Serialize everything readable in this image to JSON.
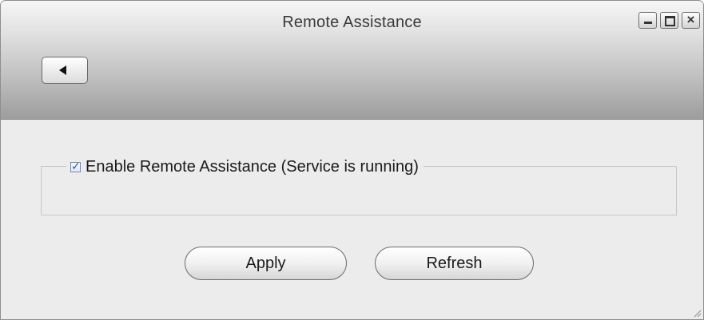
{
  "window": {
    "title": "Remote Assistance",
    "controls": {
      "minimize_icon": "minimize-icon",
      "maximize_icon": "maximize-icon",
      "close_icon": "close-icon",
      "close_glyph": "×"
    },
    "back_icon": "back-arrow-icon"
  },
  "settings": {
    "enable_checkbox_checked": true,
    "enable_label": "Enable Remote Assistance (Service is running)"
  },
  "actions": {
    "apply_label": "Apply",
    "refresh_label": "Refresh"
  },
  "colors": {
    "titlebar_top": "#f6f6f6",
    "titlebar_bottom": "#9d9d9d",
    "body_bg": "#ececec",
    "checkmark": "#2a55b8"
  }
}
